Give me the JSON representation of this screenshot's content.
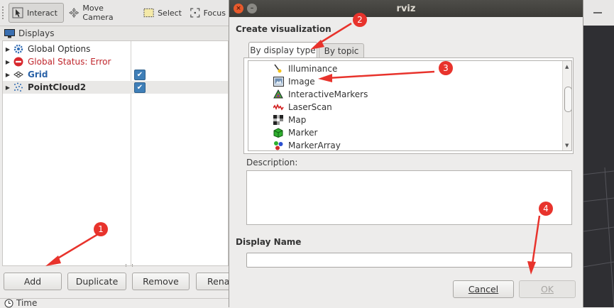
{
  "toolbar": {
    "interact": "Interact",
    "move_camera": "Move Camera",
    "select": "Select",
    "focus": "Focus"
  },
  "displays_panel": {
    "title": "Displays",
    "items": [
      {
        "label": "Global Options",
        "icon": "gear-icon",
        "color": "#2d2d2d",
        "bold": false
      },
      {
        "label": "Global Status: Error",
        "icon": "error-icon",
        "color": "#c0262c",
        "bold": false
      },
      {
        "label": "Grid",
        "icon": "grid-icon",
        "color": "#2a62a7",
        "bold": true,
        "checked": true
      },
      {
        "label": "PointCloud2",
        "icon": "pointcloud-icon",
        "color": "#2d2d2d",
        "bold": true,
        "checked": true,
        "selected": true
      }
    ],
    "buttons": {
      "add": "Add",
      "duplicate": "Duplicate",
      "remove": "Remove",
      "rename": "Rena"
    },
    "time_label": "Time"
  },
  "dialog": {
    "window_title": "rviz",
    "create_label": "Create visualization",
    "tabs": {
      "by_display_type": "By display type",
      "by_topic": "By topic"
    },
    "list_items": [
      "Illuminance",
      "Image",
      "InteractiveMarkers",
      "LaserScan",
      "Map",
      "Marker",
      "MarkerArray"
    ],
    "description_label": "Description:",
    "display_name_label": "Display Name",
    "display_name_value": "",
    "cancel": "Cancel",
    "ok": "OK"
  },
  "annotations": {
    "badges": [
      "1",
      "2",
      "3",
      "4"
    ],
    "color": "#e8332c"
  }
}
